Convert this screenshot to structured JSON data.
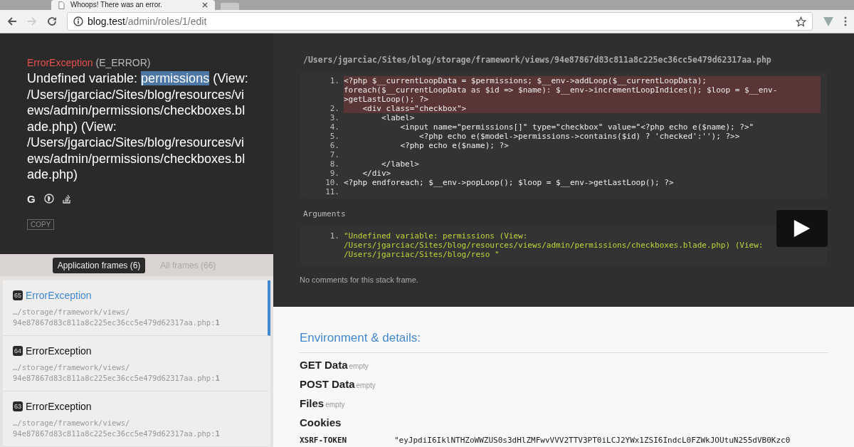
{
  "browser": {
    "tab_title": "Whoops! There was an error.",
    "url_host": "blog.test",
    "url_path": "/admin/roles/1/edit",
    "forward_disabled": true
  },
  "error": {
    "type": "ErrorException",
    "code": "(E_ERROR)",
    "message_before": "Undefined variable: ",
    "message_selected": "permissions",
    "message_after": " (View: /Users/jgarciac/Sites/blog/resources/views/admin/permissions/checkboxes.blade.php) (View: /Users/jgarciac/Sites/blog/resources/views/admin/permissions/checkboxes.blade.php)",
    "search_letter": "G",
    "copy_label": "COPY"
  },
  "frame_tabs": [
    {
      "label": "Application frames (6)",
      "selected": true
    },
    {
      "label": "All frames (66)",
      "selected": false
    }
  ],
  "frames": [
    {
      "number": "65",
      "name": "ErrorException",
      "path": "…/storage/framework/views/ 94e87867d83c811a8c225ec36cc5e479d62317aa.php:**1**",
      "selected": true
    },
    {
      "number": "64",
      "name": "ErrorException",
      "path": "…/storage/framework/views/ 94e87867d83c811a8c225ec36cc5e479d62317aa.php:**1**",
      "selected": false
    },
    {
      "number": "63",
      "name": "ErrorException",
      "path": "…/storage/framework/views/ 94e87867d83c811a8c225ec36cc5e479d62317aa.php:**1**",
      "selected": false
    }
  ],
  "file_path": "/Users/jgarciac/Sites/blog/storage/framework/views/94e87867d83c811a8c225ec36cc5e479d62317aa.php",
  "code_lines": [
    {
      "number": "1.",
      "text": "<?php $__currentLoopData = $permissions; $__env->addLoop($__currentLoopData); foreach($__currentLoopData as $id => $name): $__env->incrementLoopIndices(); $loop = $__env->getLastLoop(); ?>",
      "highlighted": true
    },
    {
      "number": "2.",
      "text": "    <div class=\"checkbox\">",
      "highlighted": true
    },
    {
      "number": "3.",
      "text": "        <label>",
      "highlighted": false
    },
    {
      "number": "4.",
      "text": "            <input name=\"permissions[]\" type=\"checkbox\" value=\"<?php echo e($name); ?>\"",
      "highlighted": false
    },
    {
      "number": "5.",
      "text": "                <?php echo e($model->permissions->contains($id) ? 'checked':''); ?>>",
      "highlighted": false
    },
    {
      "number": "6.",
      "text": "            <?php echo e($name); ?>",
      "highlighted": false
    },
    {
      "number": "7.",
      "highlighted": false
    },
    {
      "number": "8.",
      "text": "        </label>",
      "highlighted": false
    },
    {
      "number": "9.",
      "text": "    </div>",
      "highlighted": false
    },
    {
      "number": "10.",
      "text": "<?php endforeach; $__env->popLoop(); $loop = $__env->getLastLoop(); ?>",
      "highlighted": false
    },
    {
      "number": "11.",
      "highlighted": false
    }
  ],
  "arguments_title": "Arguments",
  "arguments": [
    {
      "number": "1.",
      "text": "\"Undefined variable: permissions (View: /Users/jgarciac/Sites/blog/resources/views/admin/permissions/checkboxes.blade.php) (View: /Users/jgarciac/Sites/blog/reso \""
    }
  ],
  "comments_note": "No comments for this stack frame.",
  "environment": {
    "title": "Environment & details:",
    "sections": [
      {
        "name": "GET Data",
        "badge": "empty"
      },
      {
        "name": "POST Data",
        "badge": "empty"
      },
      {
        "name": "Files",
        "badge": "empty"
      },
      {
        "name": "Cookies"
      }
    ],
    "cookies": [
      {
        "key": "XSRF-TOKEN",
        "value": "\"eyJpdiI6IklNTHZoWWZUS0s3dHlZMFwvVVV2TTV3PT0iLCJ2YWx1ZSI6IndcL0FZWkJOUtuN255dVB0Kzc0"
      }
    ]
  }
}
